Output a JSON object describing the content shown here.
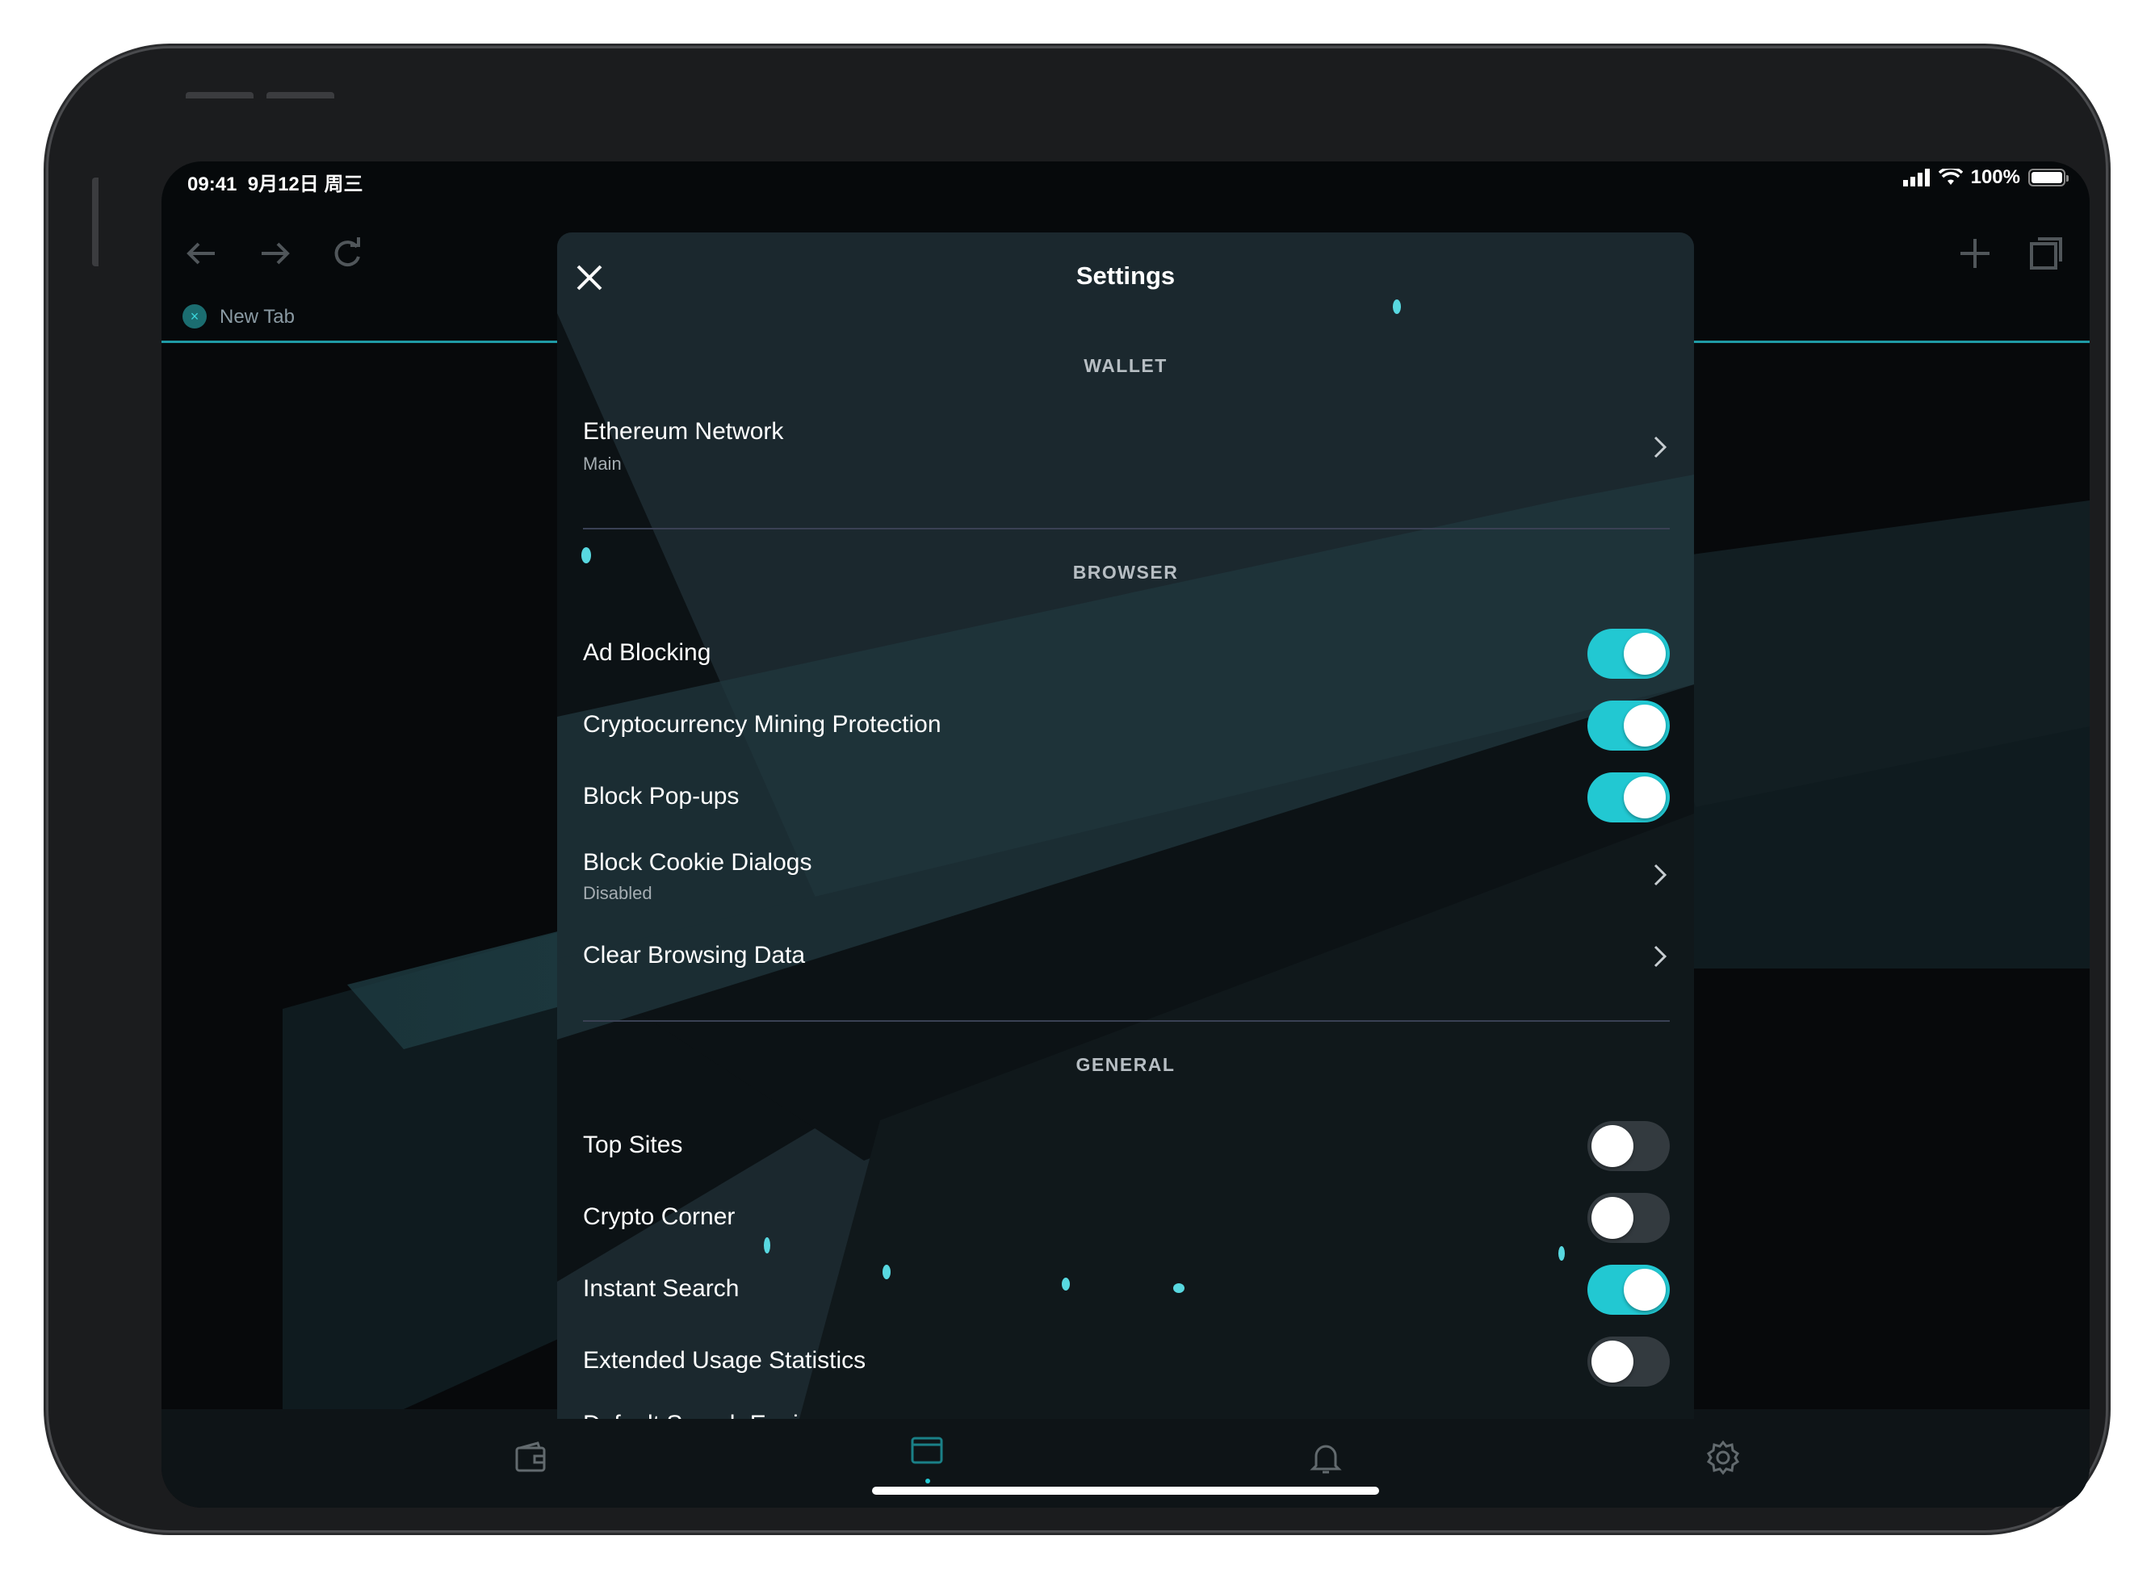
{
  "status_bar": {
    "time": "09:41",
    "date": "9月12日 周三",
    "battery": "100%"
  },
  "browser": {
    "tab_title": "New Tab",
    "tab_close_glyph": "×",
    "icons": [
      "back-arrow-icon",
      "forward-arrow-icon",
      "reload-icon",
      "new-tab-plus-icon",
      "tabs-icon"
    ],
    "accent_color": "#22c8d2"
  },
  "bottom_bar": {
    "icons": [
      "wallet-icon",
      "browser-icon",
      "notifications-bell-icon",
      "settings-gear-icon"
    ]
  },
  "settings": {
    "title": "Settings",
    "sections": {
      "wallet": "WALLET",
      "browser": "BROWSER",
      "general": "GENERAL"
    },
    "wallet": {
      "ethereum_network": {
        "label": "Ethereum Network",
        "value": "Main"
      }
    },
    "browser": {
      "ad_blocking": {
        "label": "Ad Blocking",
        "enabled": true
      },
      "crypto_mining": {
        "label": "Cryptocurrency Mining Protection",
        "enabled": true
      },
      "block_popups": {
        "label": "Block Pop-ups",
        "enabled": true
      },
      "cookie_dialogs": {
        "label": "Block Cookie Dialogs",
        "value": "Disabled"
      },
      "clear_data": {
        "label": "Clear Browsing Data"
      }
    },
    "general": {
      "top_sites": {
        "label": "Top Sites",
        "enabled": false
      },
      "crypto_corner": {
        "label": "Crypto Corner",
        "enabled": false
      },
      "instant_search": {
        "label": "Instant Search",
        "enabled": true
      },
      "usage_stats": {
        "label": "Extended Usage Statistics",
        "enabled": false
      },
      "search_engine": {
        "label": "Default Search Engine"
      }
    }
  }
}
